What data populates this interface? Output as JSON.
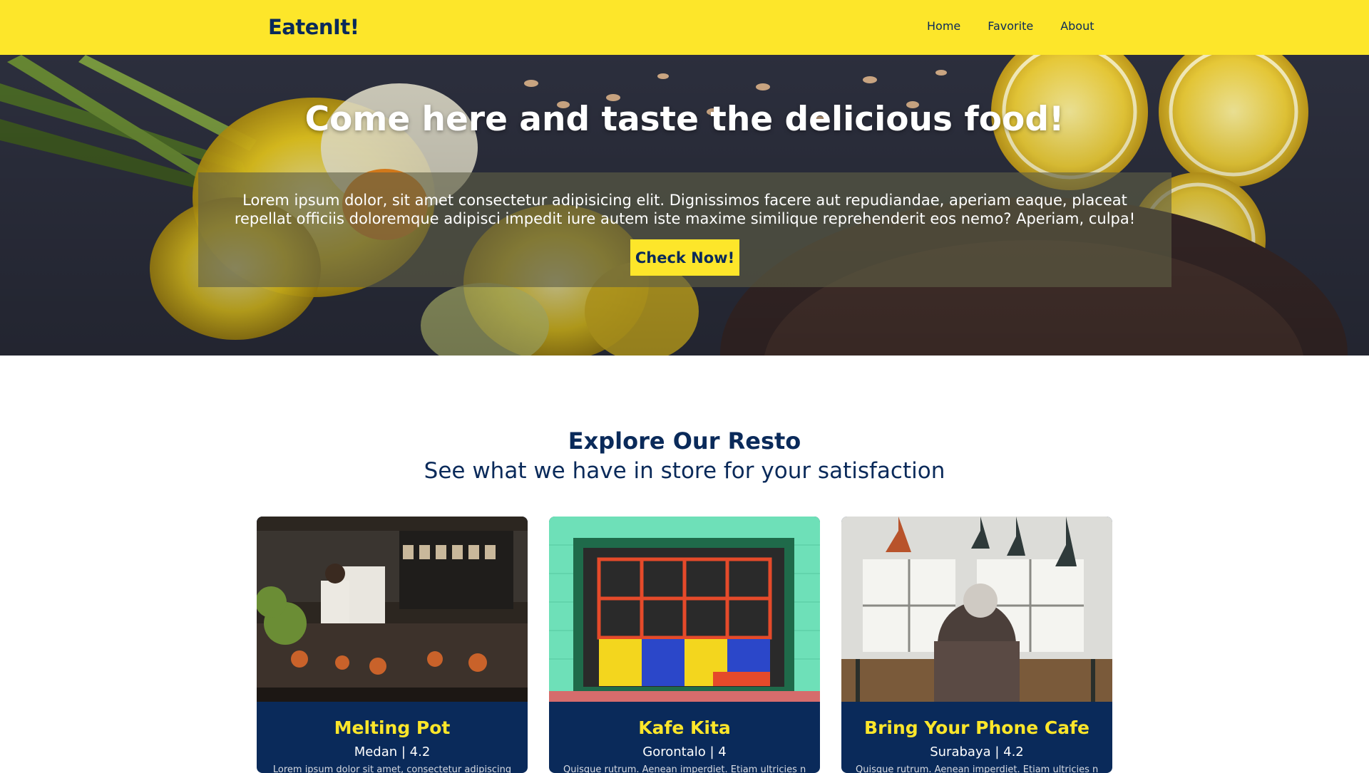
{
  "navbar": {
    "brand": "EatenIt!",
    "links": [
      "Home",
      "Favorite",
      "About"
    ],
    "bg_color": "#fde62a"
  },
  "hero": {
    "title": "Come here and taste the delicious food!",
    "text": "Lorem ipsum dolor, sit amet consectetur adipisicing elit. Dignissimos facere aut repudiandae, aperiam eaque, placeat repellat officiis doloremque adipisci impedit iure autem iste maxime similique reprehenderit eos nemo? Aperiam, culpa!",
    "button_label": "Check Now!"
  },
  "explore": {
    "title": "Explore Our Resto",
    "subtitle": "See what we have in store for your satisfaction"
  },
  "restaurants": [
    {
      "name": "Melting Pot",
      "meta": "Medan | 4.2",
      "desc": "Lorem ipsum dolor sit amet, consectetur adipiscing"
    },
    {
      "name": "Kafe Kita",
      "meta": "Gorontalo | 4",
      "desc": "Quisque rutrum. Aenean imperdiet. Etiam ultricies nisi"
    },
    {
      "name": "Bring Your Phone Cafe",
      "meta": "Surabaya | 4.2",
      "desc": "Quisque rutrum. Aenean imperdiet. Etiam ultricies nisi"
    }
  ],
  "colors": {
    "primary": "#fde62a",
    "secondary": "#0a2a5a"
  }
}
